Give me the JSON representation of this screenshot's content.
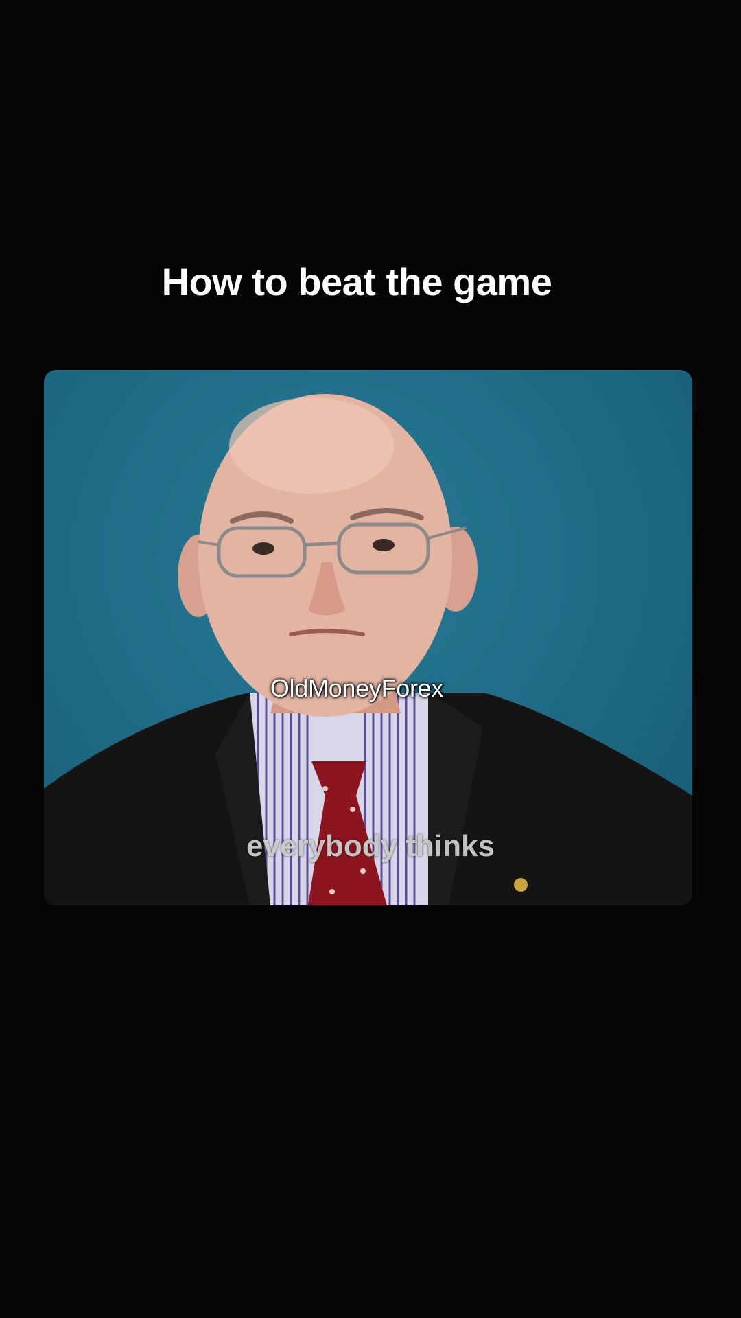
{
  "post": {
    "title": "How to beat the game",
    "watermark": "OldMoneyForex",
    "subtitle": "everybody thinks"
  },
  "colors": {
    "background": "#050505",
    "video_backdrop": "#1f6d88",
    "suit": "#141414",
    "tie": "#8c1520"
  }
}
